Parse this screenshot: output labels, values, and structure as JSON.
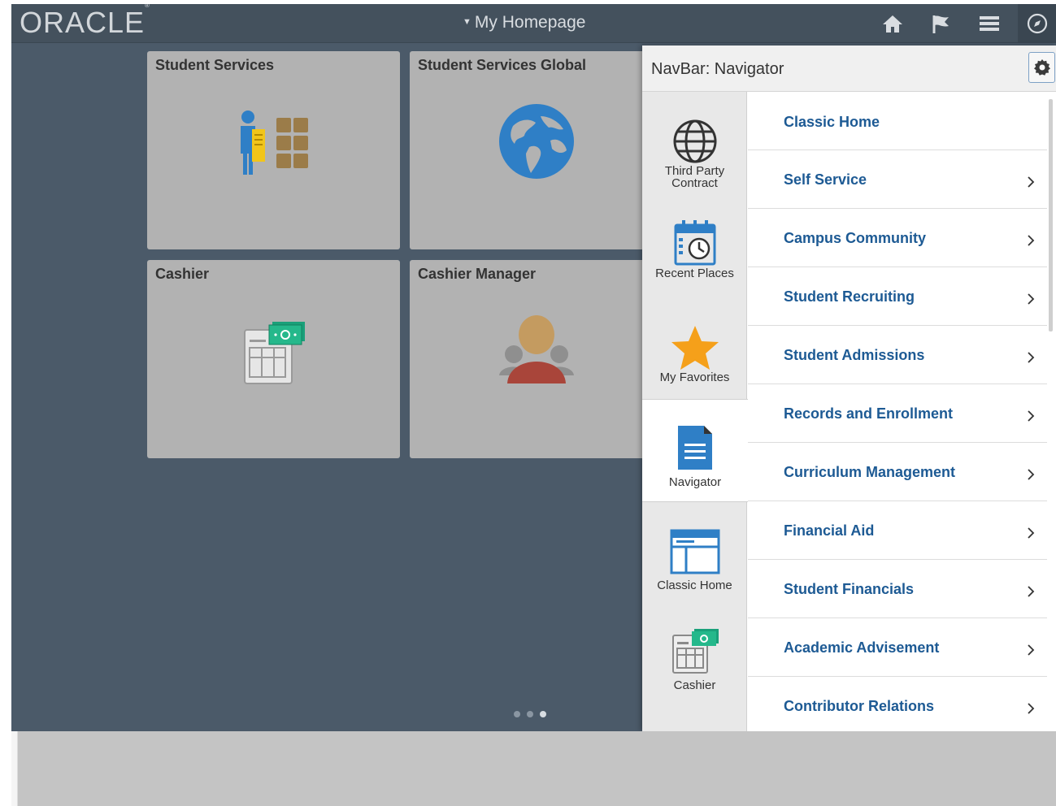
{
  "header": {
    "logo": "ORACLE",
    "logo_mark": "®",
    "title": "My Homepage"
  },
  "tiles": [
    {
      "title": "Student Services",
      "icon": "student-services-icon"
    },
    {
      "title": "Student Services Global",
      "icon": "globe-icon"
    },
    {
      "title": "Cashier",
      "icon": "cashier-register-icon"
    },
    {
      "title": "Cashier Manager",
      "icon": "manager-people-icon"
    }
  ],
  "page_indicator": {
    "pages": 3,
    "active": 3
  },
  "navbar": {
    "title": "NavBar: Navigator",
    "tabs": [
      {
        "label": "Third Party Contract",
        "icon": "globe-icon"
      },
      {
        "label": "Recent Places",
        "icon": "calendar-clock-icon"
      },
      {
        "label": "My Favorites",
        "icon": "star-icon"
      },
      {
        "label": "Navigator",
        "icon": "document-icon"
      },
      {
        "label": "Classic Home",
        "icon": "window-icon"
      },
      {
        "label": "Cashier",
        "icon": "cashier-register-icon"
      }
    ],
    "items": [
      {
        "label": "Classic Home",
        "has_children": false
      },
      {
        "label": "Self Service",
        "has_children": true
      },
      {
        "label": "Campus Community",
        "has_children": true
      },
      {
        "label": "Student Recruiting",
        "has_children": true
      },
      {
        "label": "Student Admissions",
        "has_children": true
      },
      {
        "label": "Records and Enrollment",
        "has_children": true
      },
      {
        "label": "Curriculum Management",
        "has_children": true
      },
      {
        "label": "Financial Aid",
        "has_children": true
      },
      {
        "label": "Student Financials",
        "has_children": true
      },
      {
        "label": "Academic Advisement",
        "has_children": true
      },
      {
        "label": "Contributor Relations",
        "has_children": true
      }
    ]
  },
  "colors": {
    "header_bg": "#44515d",
    "page_bg": "#4b5a69",
    "tile_bg": "#b2b2b2",
    "link": "#1d5a94",
    "icon_blue": "#2f7fc6",
    "star": "#f5a01a"
  }
}
